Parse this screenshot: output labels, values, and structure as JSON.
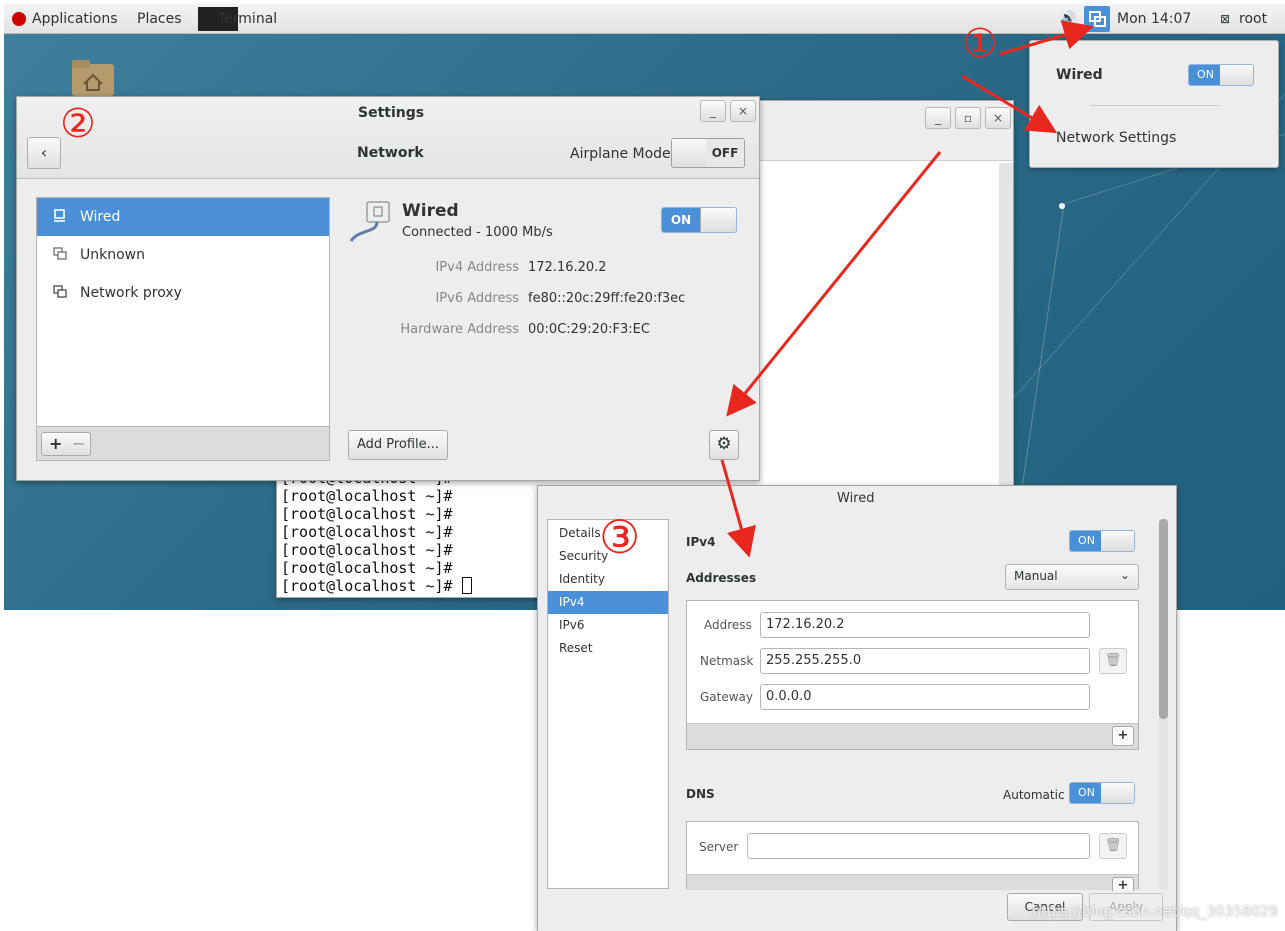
{
  "topbar": {
    "applications": "Applications",
    "places": "Places",
    "terminal": "Terminal",
    "clock": "Mon 14:07",
    "user": "root"
  },
  "popup": {
    "wired_label": "Wired",
    "switch_on": "ON",
    "network_settings": "Network Settings"
  },
  "settings": {
    "title": "Settings",
    "section": "Network",
    "airplane_mode": "Airplane Mode",
    "airplane_state": "OFF",
    "sidebar": [
      {
        "label": "Wired",
        "icon": "wired-icon"
      },
      {
        "label": "Unknown",
        "icon": "vpn-icon"
      },
      {
        "label": "Network proxy",
        "icon": "proxy-icon"
      }
    ],
    "add": "+",
    "remove": "−",
    "detail": {
      "name": "Wired",
      "status": "Connected - 1000 Mb/s",
      "switch_on": "ON",
      "rows": [
        {
          "key": "IPv4 Address",
          "value": "172.16.20.2"
        },
        {
          "key": "IPv6 Address",
          "value": "fe80::20c:29ff:fe20:f3ec"
        },
        {
          "key": "Hardware Address",
          "value": "00:0C:29:20:F3:EC"
        }
      ],
      "add_profile": "Add Profile..."
    }
  },
  "terminal": {
    "lines": [
      "[root@localhost ~]#",
      "[root@localhost ~]#",
      "[root@localhost ~]#",
      "[root@localhost ~]#",
      "[root@localhost ~]#",
      "[root@localhost ~]#",
      "[root@localhost ~]#"
    ]
  },
  "wired_dialog": {
    "title": "Wired",
    "tabs": [
      "Details",
      "Security",
      "Identity",
      "IPv4",
      "IPv6",
      "Reset"
    ],
    "active_tab": "IPv4",
    "ipv4_label": "IPv4",
    "ipv4_switch": "ON",
    "addresses_label": "Addresses",
    "method": "Manual",
    "address_label": "Address",
    "address_value": "172.16.20.2",
    "netmask_label": "Netmask",
    "netmask_value": "255.255.255.0",
    "gateway_label": "Gateway",
    "gateway_value": "0.0.0.0",
    "plus": "+",
    "dns_label": "DNS",
    "automatic_label": "Automatic",
    "dns_switch": "ON",
    "server_label": "Server",
    "server_value": "",
    "cancel": "Cancel",
    "apply": "Apply"
  },
  "annotations": {
    "one": "①",
    "two": "②",
    "three": "③"
  },
  "watermark": "https://blog.csdn.net/qq_30358029",
  "colors": {
    "accent": "#4a90d9",
    "annotation": "#e8271f",
    "desktop": "#2c6b87"
  }
}
